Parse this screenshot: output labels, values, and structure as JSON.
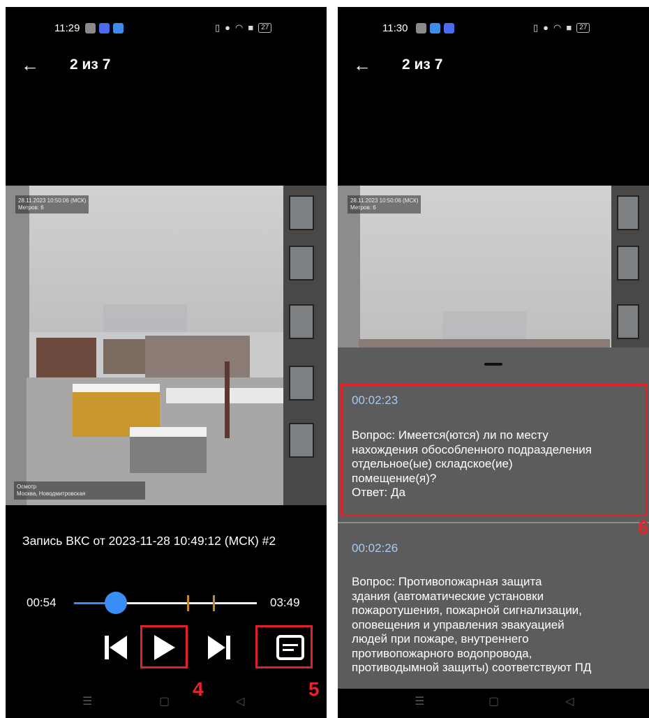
{
  "left": {
    "status": {
      "time": "11:29",
      "battery": "27"
    },
    "header": {
      "back_icon": "arrow-left-icon",
      "title": "2 из 7"
    },
    "video": {
      "overlay_line1": "28.11.2023 10:50:06 (МСК)",
      "overlay_line2": "Метров: 6",
      "location_line1": "Осмотр",
      "location_line2": "Москва,  Новодмитровская"
    },
    "recording_title": "Запись ВКС от 2023-11-28 10:49:12 (МСК) #2",
    "player": {
      "current_time": "00:54",
      "total_time": "03:49",
      "progress_fraction": 0.23,
      "marker_fractions": [
        0.62,
        0.76
      ]
    },
    "controls": {
      "prev_icon": "skip-previous-icon",
      "play_icon": "play-icon",
      "next_icon": "skip-next-icon",
      "subtitles_icon": "subtitles-icon"
    },
    "callouts": {
      "play": "4",
      "subtitles": "5"
    }
  },
  "right": {
    "status": {
      "time": "11:30",
      "battery": "27"
    },
    "header": {
      "back_icon": "arrow-left-icon",
      "title": "2 из 7"
    },
    "video": {
      "overlay_line1": "28.11.2023 10:50:06 (МСК)",
      "overlay_line2": "Метров: 6"
    },
    "transcript": [
      {
        "time": "00:02:23",
        "text": "Вопрос: Имеется(ются) ли по месту\nнахождения обособленного подразделения\nотдельное(ые) складское(ие)\nпомещение(я)?\nОтвет: Да"
      },
      {
        "time": "00:02:26",
        "text": "Вопрос: Противопожарная защита\nздания (автоматические установки\nпожаротушения, пожарной сигнализации,\nоповещения и управления эвакуацией\nлюдей при пожаре, внутреннего\nпротивопожарного водопровода,\nпротиводымной защиты) соответствуют ПД"
      }
    ],
    "callout": "6"
  },
  "colors": {
    "accent": "#3a8df5",
    "highlight": "#e01f2b",
    "marker": "#c5892c",
    "sheet_bg": "#5c5c5c",
    "timestamp": "#a8cbf0"
  }
}
